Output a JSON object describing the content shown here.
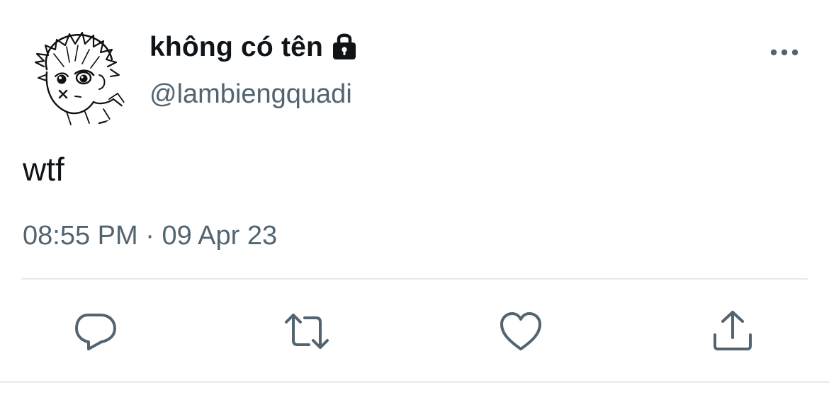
{
  "author": {
    "display_name": "không có tên",
    "handle": "@lambiengquadi",
    "protected_icon": "lock-icon",
    "avatar_icon": "sketch-avatar"
  },
  "tweet": {
    "text": "wtf",
    "time": "08:55 PM",
    "separator": "·",
    "date": "09 Apr 23"
  },
  "menu": {
    "more_icon": "more-horizontal-icon"
  },
  "actions": [
    {
      "name": "reply",
      "icon": "reply-bubble-icon"
    },
    {
      "name": "retweet",
      "icon": "retweet-icon"
    },
    {
      "name": "like",
      "icon": "heart-icon"
    },
    {
      "name": "share",
      "icon": "share-upload-icon"
    }
  ],
  "colors": {
    "text_primary": "#0f1419",
    "text_secondary": "#536471",
    "divider": "#e6e9eb",
    "background": "#ffffff"
  }
}
